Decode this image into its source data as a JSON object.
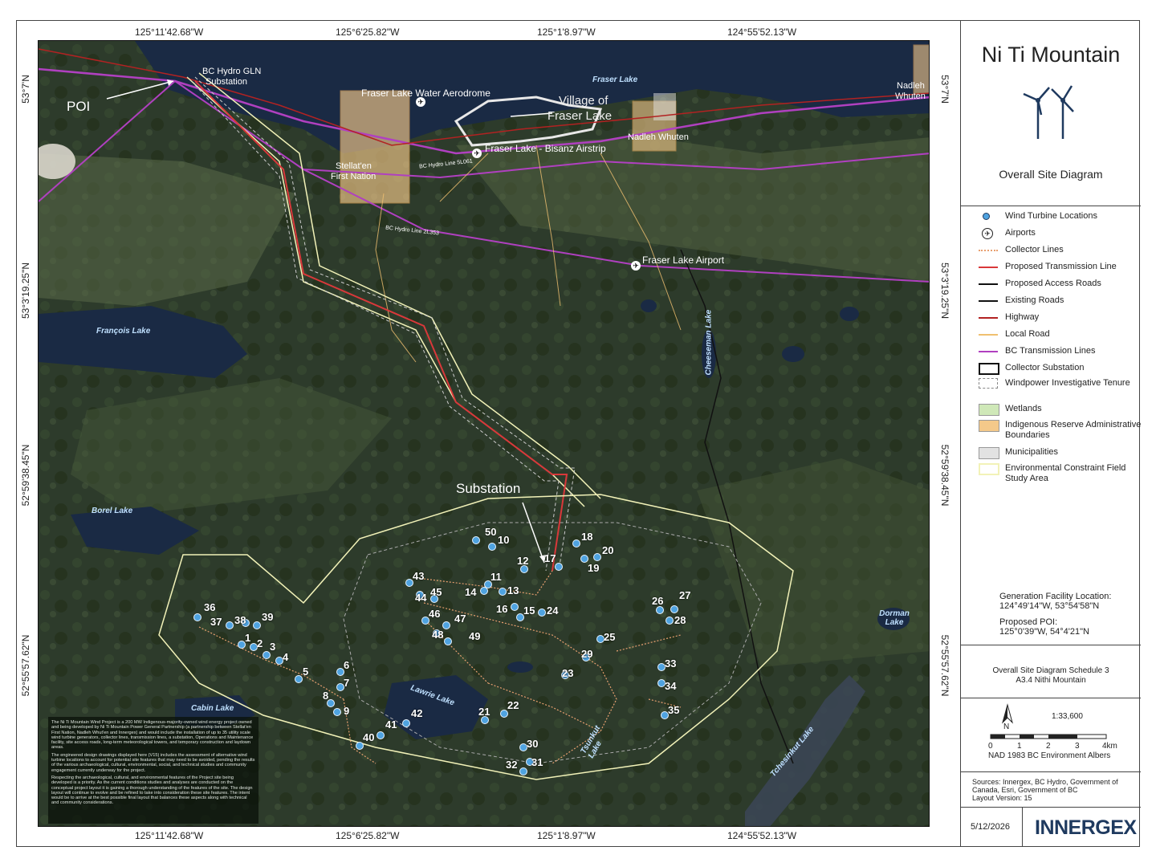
{
  "title": "Ni Ti Mountain",
  "subtitle": "Overall Site Diagram",
  "coordinates": {
    "top": [
      "125°11'42.68\"W",
      "125°6'25.82\"W",
      "125°1'8.97\"W",
      "124°55'52.13\"W"
    ],
    "bottom": [
      "125°11'42.68\"W",
      "125°6'25.82\"W",
      "125°1'8.97\"W",
      "124°55'52.13\"W"
    ],
    "left": [
      "53°7'N",
      "53°3'19.25\"N",
      "52°59'38.45\"N",
      "52°55'57.62\"N"
    ],
    "right": [
      "53°7'N",
      "53°3'19.25\"N",
      "52°59'38.45\"N",
      "52°55'57.62\"N"
    ]
  },
  "legend": [
    {
      "label": "Wind Turbine Locations",
      "symbol": "turbine"
    },
    {
      "label": "Airports",
      "symbol": "airport"
    },
    {
      "label": "Collector Lines",
      "symbol": "dotted",
      "color": "#e8a070"
    },
    {
      "label": "Proposed Transmission Line",
      "symbol": "line",
      "color": "#d9383a"
    },
    {
      "label": "Proposed Access Roads",
      "symbol": "line",
      "color": "#111111"
    },
    {
      "label": "Existing Roads",
      "symbol": "line",
      "color": "#111111"
    },
    {
      "label": "Highway",
      "symbol": "line",
      "color": "#b22222"
    },
    {
      "label": "Local Road",
      "symbol": "line",
      "color": "#f0c070"
    },
    {
      "label": "BC Transmission Lines",
      "symbol": "line",
      "color": "#b040c0"
    },
    {
      "label": "Collector Substation",
      "symbol": "box",
      "color": "#111111"
    },
    {
      "label": "Windpower Investigative Tenure",
      "symbol": "dashbox",
      "color": "#888888"
    },
    {
      "label": "Wetlands",
      "symbol": "fill",
      "color": "#cfe8b8"
    },
    {
      "label": "Indigenous Reserve Administrative Boundaries",
      "symbol": "fill",
      "color": "#f4c98a"
    },
    {
      "label": "Municipalities",
      "symbol": "fill",
      "color": "#e2e2e2"
    },
    {
      "label": "Environmental Constraint Field Study Area",
      "symbol": "box",
      "color": "#f2f2b8"
    }
  ],
  "location_info": {
    "generation_label": "Generation Facility Location:",
    "generation_value": "124°49'14\"W, 53°54'58\"N",
    "poi_label": "Proposed POI:",
    "poi_value": "125°0'39\"W, 54°4'21\"N"
  },
  "schedule": {
    "line1": "Overall Site Diagram Schedule 3",
    "line2": "A3.4 Nithi Mountain"
  },
  "scale": {
    "north": "N",
    "ratio": "1:33,600",
    "ticks": [
      "0",
      "1",
      "2",
      "3",
      "4km"
    ],
    "projection": "NAD 1983 BC Environment Albers"
  },
  "sources": {
    "line1": "Sources: Innergex, BC Hydro, Government of",
    "line2": "Canada, Esri, Government of BC",
    "line3": "Layout Version: 15"
  },
  "date": "5/12/2026",
  "brand": "INNERGEX",
  "brand_color": "#1f3a5f",
  "map_labels": {
    "poi": "POI",
    "substation_top_1": "BC Hydro GLN",
    "substation_top_2": "Substation",
    "substation": "Substation",
    "aerodrome": "Fraser Lake Water Aerodrome",
    "village_1": "Village of",
    "village_2": "Fraser Lake",
    "airstrip": "Fraser Lake - Bisanz Airstrip",
    "nadleh_1": "Nadleh",
    "nadleh_2": "Whuten",
    "nadleh_whuten": "Nadleh Whuten",
    "stellaten_1": "Stellat'en",
    "stellaten_2": "First Nation",
    "airport": "Fraser Lake Airport",
    "bc_line_1": "BC Hydro Line 5L061",
    "bc_line_2": "BC Hydro Line 2L353",
    "fraser_lake": "Fraser Lake",
    "francois_lake": "François Lake",
    "borel_lake": "Borel Lake",
    "cabin_lake": "Cabin Lake",
    "lawrie_lake": "Lawrie Lake",
    "dorman_lake": "Dorman Lake",
    "cheeseman_lake": "Cheeseman Lake",
    "tchesinkut_lake": "Tchesinkut Lake",
    "tsunkut_lake": "Tsunkut Lake"
  },
  "turbines": [
    "50",
    "10",
    "18",
    "20",
    "17",
    "19",
    "12",
    "11",
    "43",
    "44",
    "45",
    "14",
    "13",
    "16",
    "15",
    "24",
    "46",
    "47",
    "48",
    "49",
    "36",
    "37",
    "38",
    "39",
    "1",
    "2",
    "3",
    "4",
    "5",
    "6",
    "7",
    "8",
    "9",
    "40",
    "41",
    "42",
    "21",
    "22",
    "29",
    "25",
    "23",
    "30",
    "31",
    "32",
    "26",
    "27",
    "28",
    "33",
    "34",
    "35"
  ],
  "note": [
    "The Ni Ti Mountain Wind Project is a 200 MW Indigenous-majority-owned wind energy project owned and being developed by Ni Ti Mountain Power General Partnership (a partnership between Stellat'en First Nation, Nadleh Whut'en and Innergex) and would include the installation of up to 35 utility scale wind turbine generators, collector lines, transmission lines, a substation, Operations and Maintenance facility, site access roads, long-term meteorological towers, and temporary construction and laydown areas.",
    "The engineered design drawings displayed here (V15) includes the assessment of alternative wind turbine locations to account for potential site features that may need to be avoided, pending the results of the various archaeological, cultural, environmental, social, and technical studies and community engagement currently underway for the project.",
    "Respecting the archaeological, cultural, and environmental features of the Project site being developed is a priority. As the current conditions studies and analyses are conducted on the conceptual project layout it is gaining a thorough understanding of the features of the site. The design layout will continue to evolve and be refined to take into consideration these site features. The intent would be to arrive at the best possible final layout that balances these aspects along with technical and community considerations."
  ]
}
